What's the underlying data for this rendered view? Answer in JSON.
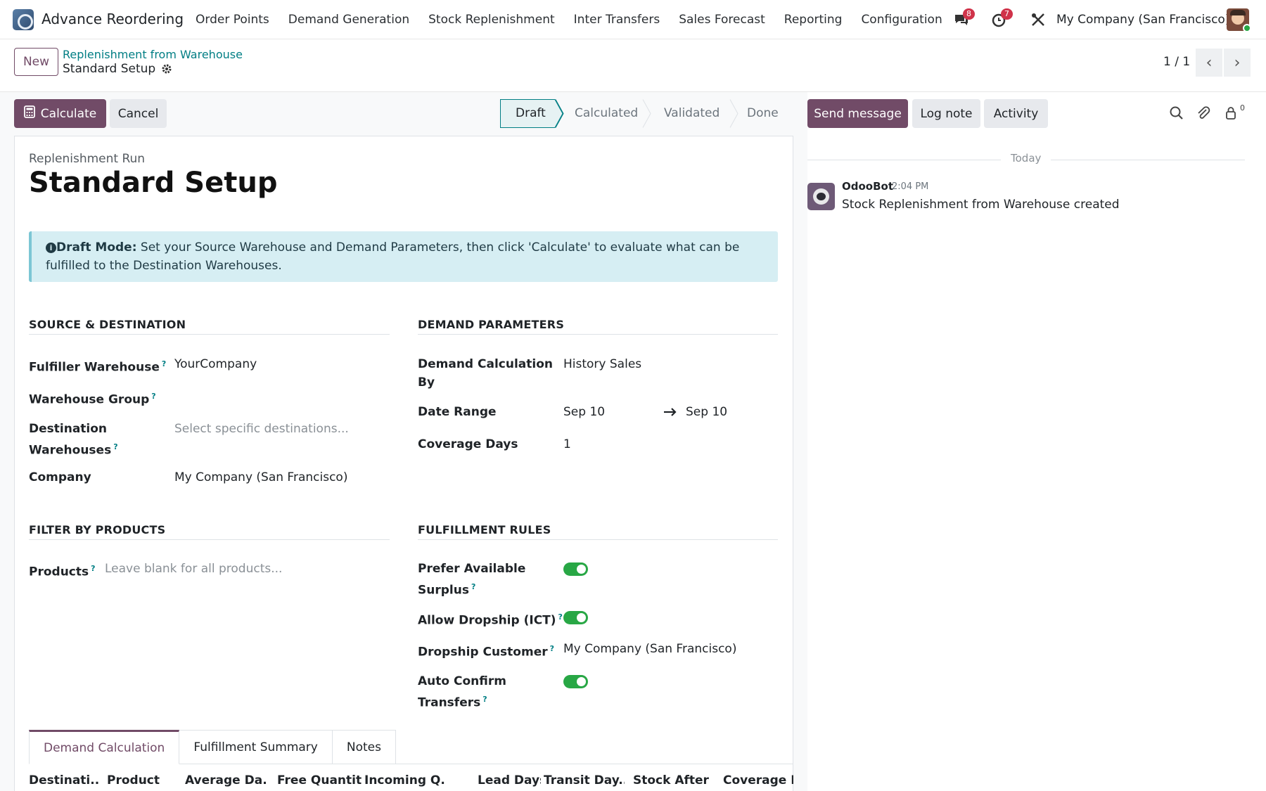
{
  "navbar": {
    "app_name": "Advance Reordering",
    "menu": [
      "Order Points",
      "Demand Generation",
      "Stock Replenishment",
      "Inter Transfers",
      "Sales Forecast",
      "Reporting",
      "Configuration"
    ],
    "messages_count": "8",
    "activities_count": "7",
    "company": "My Company (San Francisco)",
    "icons": [
      "chat-icon",
      "clock-icon",
      "tools-icon"
    ]
  },
  "control": {
    "new_label": "New",
    "breadcrumb_parent": "Replenishment from Warehouse",
    "breadcrumb_current": "Standard Setup",
    "pager": "1 / 1"
  },
  "actions": {
    "calculate_label": "Calculate",
    "cancel_label": "Cancel",
    "stages": [
      "Draft",
      "Calculated",
      "Validated",
      "Done"
    ],
    "active_stage": "Draft"
  },
  "chatter": {
    "send_message": "Send message",
    "log_note": "Log note",
    "activity": "Activity",
    "followers_count": "0",
    "date_separator": "Today",
    "message": {
      "author": "OdooBot",
      "time": "2:04 PM",
      "body": "Stock Replenishment from Warehouse created"
    }
  },
  "form": {
    "record_type": "Replenishment Run",
    "title": "Standard Setup",
    "alert_bold": "Draft Mode:",
    "alert_text": " Set your Source Warehouse and Demand Parameters, then click 'Calculate' to evaluate what can be fulfilled to the Destination Warehouses.",
    "source_section": "SOURCE & DESTINATION",
    "demand_section": "DEMAND PARAMETERS",
    "filter_section": "FILTER BY PRODUCTS",
    "rules_section": "FULFILLMENT RULES",
    "fields": {
      "fulfiller_label": "Fulfiller Warehouse",
      "fulfiller_value": "YourCompany",
      "group_label": "Warehouse Group",
      "dest_label_1": "Destination",
      "dest_label_2": "Warehouses",
      "dest_placeholder": "Select specific destinations...",
      "company_label": "Company",
      "company_value": "My Company (San Francisco)",
      "calc_by_label_1": "Demand Calculation",
      "calc_by_label_2": "By",
      "calc_by_value": "History Sales",
      "date_range_label": "Date Range",
      "date_from": "Sep 10",
      "date_to": "Sep 10",
      "coverage_label": "Coverage Days",
      "coverage_value": "1",
      "products_label": "Products",
      "products_placeholder": "Leave blank for all products...",
      "surplus_label_1": "Prefer Available",
      "surplus_label_2": "Surplus",
      "dropship_label": "Allow Dropship (ICT)",
      "dropship_customer_label": "Dropship Customer",
      "dropship_customer_value": "My Company (San Francisco)",
      "auto_confirm_label_1": "Auto Confirm",
      "auto_confirm_label_2": "Transfers"
    },
    "toggles": {
      "prefer_surplus": true,
      "allow_dropship": true,
      "auto_confirm": true
    },
    "help_mark": "?"
  },
  "tabs": [
    "Demand Calculation",
    "Fulfillment Summary",
    "Notes"
  ],
  "active_tab": "Demand Calculation",
  "table_columns": [
    "Destinati...",
    "Product",
    "Average Da...",
    "Free Quantity",
    "Incoming Q...",
    "Lead Days",
    "Transit Day...",
    "Stock After ...",
    "Coverage D."
  ],
  "colors": {
    "primary": "#714b67",
    "teal": "#017e84",
    "toggle_on": "#28a745",
    "badge": "#d0334a"
  }
}
